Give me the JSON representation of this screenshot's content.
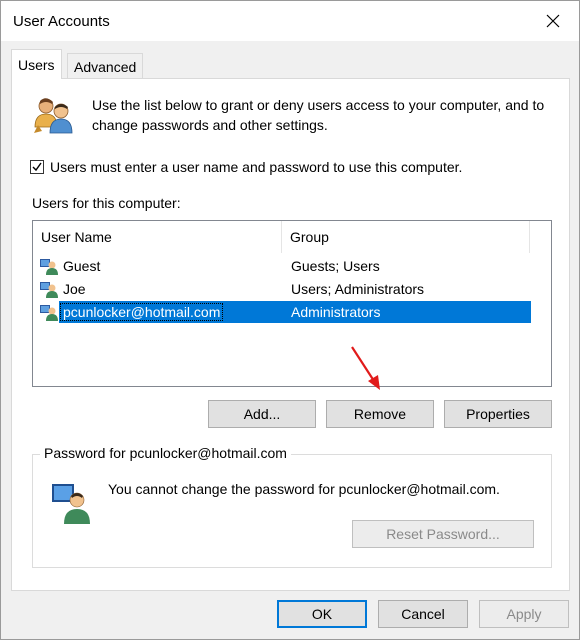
{
  "window": {
    "title": "User Accounts",
    "close_icon": "close-icon"
  },
  "tabs": [
    {
      "label": "Users",
      "active": true
    },
    {
      "label": "Advanced",
      "active": false
    }
  ],
  "users_tab": {
    "intro_text": "Use the list below to grant or deny users access to your computer, and to change passwords and other settings.",
    "require_login_checkbox": {
      "label": "Users must enter a user name and password to use this computer.",
      "checked": true
    },
    "section_label": "Users for this computer:",
    "columns": [
      "User Name",
      "Group"
    ],
    "users": [
      {
        "name": "Guest",
        "group": "Guests; Users",
        "selected": false
      },
      {
        "name": "Joe",
        "group": "Users; Administrators",
        "selected": false
      },
      {
        "name": "pcunlocker@hotmail.com",
        "group": "Administrators",
        "selected": true
      }
    ],
    "buttons": {
      "add": "Add...",
      "remove": "Remove",
      "properties": "Properties"
    },
    "password_group": {
      "title": "Password for pcunlocker@hotmail.com",
      "message": "You cannot change the password for pcunlocker@hotmail.com.",
      "reset_button": "Reset Password..."
    }
  },
  "footer": {
    "ok": "OK",
    "cancel": "Cancel",
    "apply": "Apply"
  },
  "colors": {
    "selection": "#0078d7",
    "annotation_arrow": "#e11b1b"
  }
}
